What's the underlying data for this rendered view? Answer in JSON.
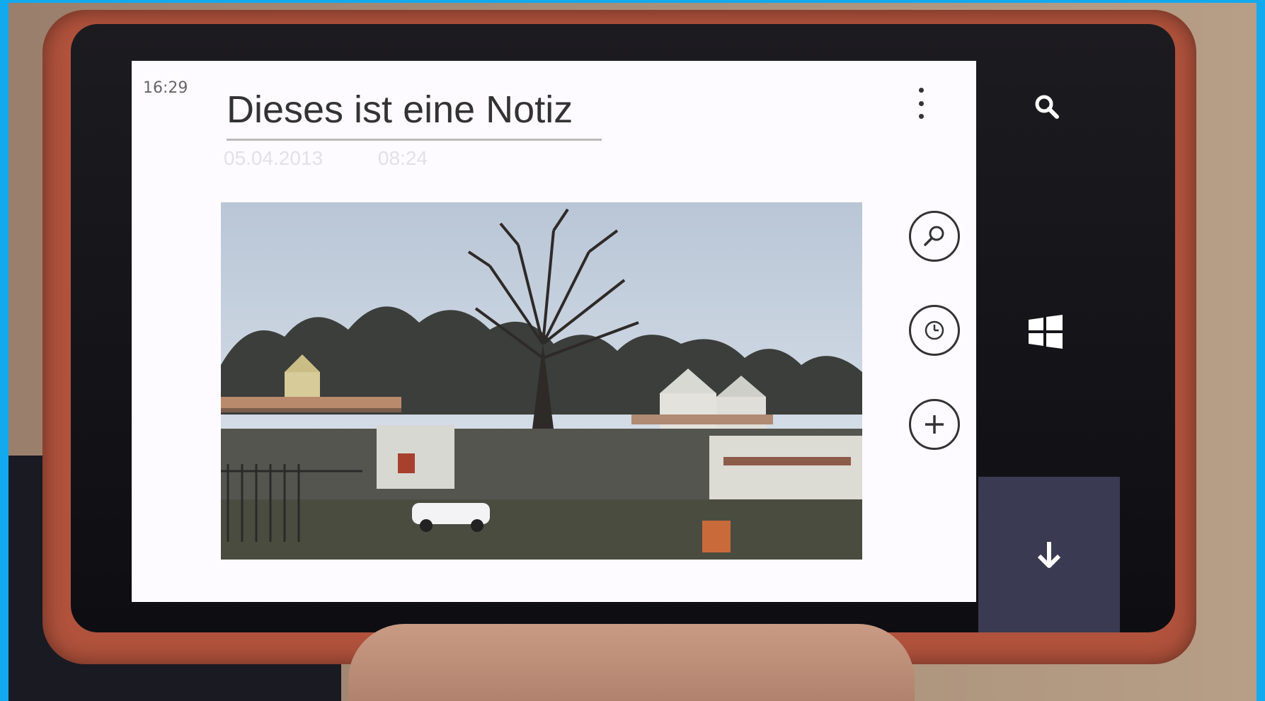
{
  "status": {
    "time": "16:29"
  },
  "note": {
    "title": "Dieses ist eine Notiz",
    "date": "05.04.2013",
    "time": "08:24",
    "image_icon": "photo-attachment"
  },
  "actions": [
    {
      "name": "zoom",
      "icon": "magnifier-icon"
    },
    {
      "name": "reminder",
      "icon": "clock-icon"
    },
    {
      "name": "add",
      "icon": "plus-icon"
    }
  ],
  "hardware_keys": [
    "search-icon",
    "windows-logo-icon",
    "down-arrow-icon"
  ],
  "colors": {
    "frame": "#12a9ee",
    "screen": "#fdfbff",
    "text": "#333333",
    "phone_shell": "#b0523c"
  }
}
